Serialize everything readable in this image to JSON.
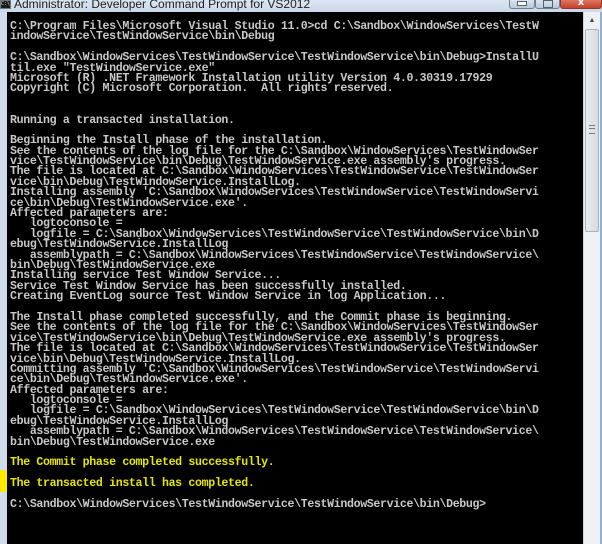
{
  "window": {
    "title": "Administrator: Developer Command Prompt for VS2012",
    "icon": "cmd-icon",
    "icon_text": "C:\\",
    "controls": {
      "minimize": "minimize-icon",
      "maximize": "maximize-icon",
      "close": "close-icon",
      "close_glyph": "x"
    }
  },
  "console": {
    "text_color": "#c0c0c0",
    "highlight_color": "#e6e600",
    "lines": [
      {
        "text": "C:\\Program Files\\Microsoft Visual Studio 11.0>cd C:\\Sandbox\\WindowServices\\TestW",
        "style": "normal"
      },
      {
        "text": "indowService\\TestWindowService\\bin\\Debug",
        "style": "normal"
      },
      {
        "text": "",
        "style": "normal"
      },
      {
        "text": "C:\\Sandbox\\WindowServices\\TestWindowService\\TestWindowService\\bin\\Debug>InstallU",
        "style": "normal"
      },
      {
        "text": "til.exe \"TestWindowService.exe\"",
        "style": "normal"
      },
      {
        "text": "Microsoft (R) .NET Framework Installation utility Version 4.0.30319.17929",
        "style": "normal"
      },
      {
        "text": "Copyright (C) Microsoft Corporation.  All rights reserved.",
        "style": "normal"
      },
      {
        "text": "",
        "style": "normal"
      },
      {
        "text": "",
        "style": "normal"
      },
      {
        "text": "Running a transacted installation.",
        "style": "normal"
      },
      {
        "text": "",
        "style": "normal"
      },
      {
        "text": "Beginning the Install phase of the installation.",
        "style": "normal"
      },
      {
        "text": "See the contents of the log file for the C:\\Sandbox\\WindowServices\\TestWindowSer",
        "style": "normal"
      },
      {
        "text": "vice\\TestWindowService\\bin\\Debug\\TestWindowService.exe assembly's progress.",
        "style": "normal"
      },
      {
        "text": "The file is located at C:\\Sandbox\\WindowServices\\TestWindowService\\TestWindowSer",
        "style": "normal"
      },
      {
        "text": "vice\\bin\\Debug\\TestWindowService.InstallLog.",
        "style": "normal"
      },
      {
        "text": "Installing assembly 'C:\\Sandbox\\WindowServices\\TestWindowService\\TestWindowServi",
        "style": "normal"
      },
      {
        "text": "ce\\bin\\Debug\\TestWindowService.exe'.",
        "style": "normal"
      },
      {
        "text": "Affected parameters are:",
        "style": "normal"
      },
      {
        "text": "   logtoconsole =",
        "style": "normal"
      },
      {
        "text": "   logfile = C:\\Sandbox\\WindowServices\\TestWindowService\\TestWindowService\\bin\\D",
        "style": "normal"
      },
      {
        "text": "ebug\\TestWindowService.InstallLog",
        "style": "normal"
      },
      {
        "text": "   assemblypath = C:\\Sandbox\\WindowServices\\TestWindowService\\TestWindowService\\",
        "style": "normal"
      },
      {
        "text": "bin\\Debug\\TestWindowService.exe",
        "style": "normal"
      },
      {
        "text": "Installing service Test Window Service...",
        "style": "normal"
      },
      {
        "text": "Service Test Window Service has been successfully installed.",
        "style": "normal"
      },
      {
        "text": "Creating EventLog source Test Window Service in log Application...",
        "style": "normal"
      },
      {
        "text": "",
        "style": "normal"
      },
      {
        "text": "The Install phase completed successfully, and the Commit phase is beginning.",
        "style": "normal"
      },
      {
        "text": "See the contents of the log file for the C:\\Sandbox\\WindowServices\\TestWindowSer",
        "style": "normal"
      },
      {
        "text": "vice\\TestWindowService\\bin\\Debug\\TestWindowService.exe assembly's progress.",
        "style": "normal"
      },
      {
        "text": "The file is located at C:\\Sandbox\\WindowServices\\TestWindowService\\TestWindowSer",
        "style": "normal"
      },
      {
        "text": "vice\\bin\\Debug\\TestWindowService.InstallLog.",
        "style": "normal"
      },
      {
        "text": "Committing assembly 'C:\\Sandbox\\WindowServices\\TestWindowService\\TestWindowServi",
        "style": "normal"
      },
      {
        "text": "ce\\bin\\Debug\\TestWindowService.exe'.",
        "style": "normal"
      },
      {
        "text": "Affected parameters are:",
        "style": "normal"
      },
      {
        "text": "   logtoconsole =",
        "style": "normal"
      },
      {
        "text": "   logfile = C:\\Sandbox\\WindowServices\\TestWindowService\\TestWindowService\\bin\\D",
        "style": "normal"
      },
      {
        "text": "ebug\\TestWindowService.InstallLog",
        "style": "normal"
      },
      {
        "text": "   assemblypath = C:\\Sandbox\\WindowServices\\TestWindowService\\TestWindowService\\",
        "style": "normal"
      },
      {
        "text": "bin\\Debug\\TestWindowService.exe",
        "style": "normal"
      },
      {
        "text": "",
        "style": "normal"
      },
      {
        "text": "The Commit phase completed successfully.",
        "style": "yellow"
      },
      {
        "text": "",
        "style": "normal"
      },
      {
        "text": "The transacted install has completed.",
        "style": "yellow"
      },
      {
        "text": "",
        "style": "normal"
      },
      {
        "text": "C:\\Sandbox\\WindowServices\\TestWindowService\\TestWindowService\\bin\\Debug>",
        "style": "normal"
      }
    ]
  },
  "scrollbar": {
    "up_arrow": "scroll-up-icon",
    "up_glyph": "▲",
    "thumb_position": "top",
    "visible_fraction": 0.38
  }
}
